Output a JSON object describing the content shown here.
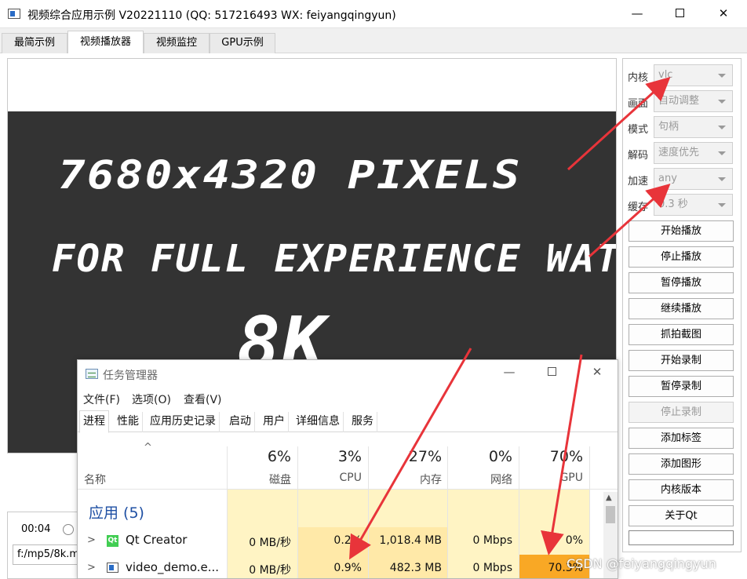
{
  "window": {
    "title": "视频综合应用示例 V20221110 (QQ: 517216493 WX: feiyangqingyun)",
    "minimize": "—",
    "close": "✕"
  },
  "tabs": [
    "最简示例",
    "视频播放器",
    "视频监控",
    "GPU示例"
  ],
  "video": {
    "line1": "7680x4320 PIXELS",
    "line2": "FOR FULL EXPERIENCE WATCH IN",
    "line3": "8K"
  },
  "player": {
    "time": "00:04",
    "path": "f:/mp5/8k.m"
  },
  "settings": {
    "kernel": {
      "label": "内核",
      "value": "vlc"
    },
    "scale": {
      "label": "画面",
      "value": "自动调整"
    },
    "mode": {
      "label": "模式",
      "value": "句柄"
    },
    "decode": {
      "label": "解码",
      "value": "速度优先"
    },
    "accel": {
      "label": "加速",
      "value": "any"
    },
    "cache": {
      "label": "缓存",
      "value": "0.3 秒"
    }
  },
  "buttons": {
    "start_play": "开始播放",
    "stop_play": "停止播放",
    "pause_play": "暂停播放",
    "resume_play": "继续播放",
    "snapshot": "抓拍截图",
    "start_record": "开始录制",
    "pause_record": "暂停录制",
    "stop_record": "停止录制",
    "add_label": "添加标签",
    "add_graph": "添加图形",
    "kernel_version": "内核版本",
    "about_qt": "关于Qt"
  },
  "task_manager": {
    "title": "任务管理器",
    "menu": [
      "文件(F)",
      "选项(O)",
      "查看(V)"
    ],
    "tabs": [
      "进程",
      "性能",
      "应用历史记录",
      "启动",
      "用户",
      "详细信息",
      "服务"
    ],
    "name_header": "名称",
    "columns": [
      {
        "name": "磁盘",
        "total": "6%"
      },
      {
        "name": "CPU",
        "total": "3%"
      },
      {
        "name": "内存",
        "total": "27%"
      },
      {
        "name": "网络",
        "total": "0%"
      },
      {
        "name": "GPU",
        "total": "70%"
      }
    ],
    "group": "应用 (5)",
    "rows": [
      {
        "name": "Qt Creator",
        "disk": "0 MB/秒",
        "cpu": "0.2%",
        "memory": "1,018.4 MB",
        "network": "0 Mbps",
        "gpu": "0%"
      },
      {
        "name": "video_demo.e...",
        "disk": "0 MB/秒",
        "cpu": "0.9%",
        "memory": "482.3 MB",
        "network": "0 Mbps",
        "gpu": "70.3%"
      }
    ]
  },
  "watermark": "CSDN @feiyangqingyun",
  "colors": {
    "arrow": "#e8343a",
    "gpu_highlight": "#f9a825",
    "cell_light": "#fff4c4",
    "cell_mid": "#ffe9a8",
    "group_blue": "#1e4fa3"
  }
}
